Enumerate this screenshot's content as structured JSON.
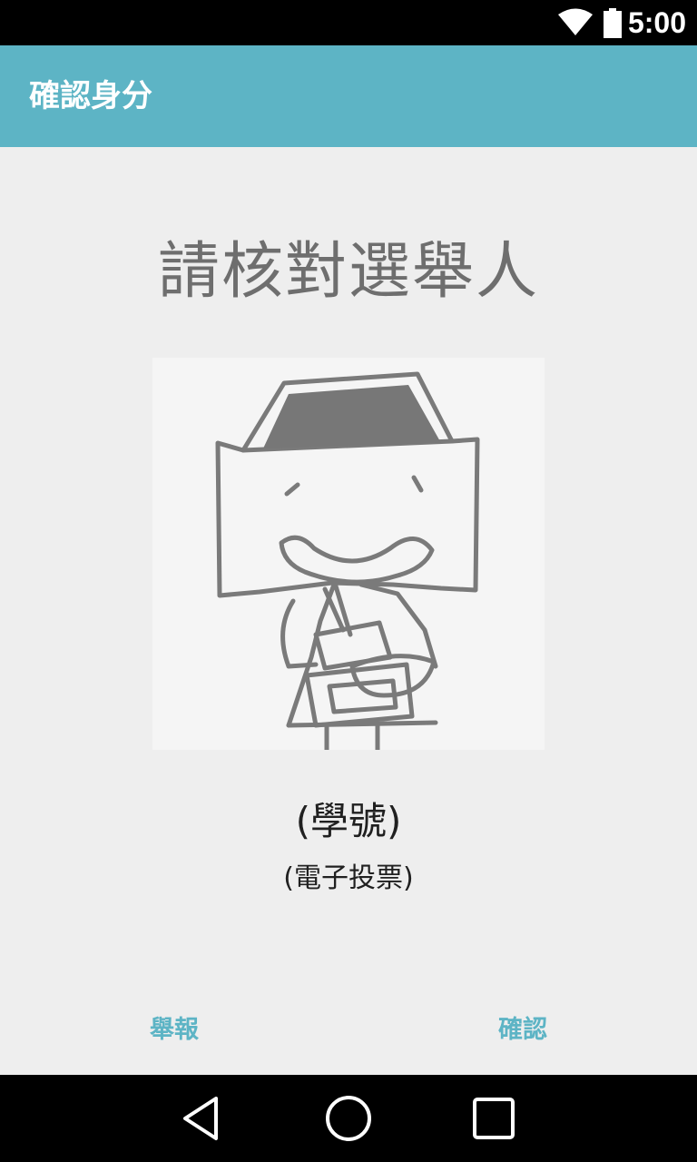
{
  "status_bar": {
    "time": "5:00",
    "icons": [
      "wifi-icon",
      "battery-icon"
    ]
  },
  "app_bar": {
    "title": "確認身分"
  },
  "main": {
    "heading": "請核對選舉人",
    "avatar_icon": "sketch-character-avatar",
    "name": "(學號)",
    "event": "(電子投票)"
  },
  "actions": {
    "report_label": "舉報",
    "confirm_label": "確認"
  },
  "nav_bar": {
    "icons": [
      "back-icon",
      "home-icon",
      "recent-apps-icon"
    ]
  },
  "colors": {
    "accent": "#5db4c5",
    "background": "#eeeeee",
    "heading_text": "#6e6e6e"
  }
}
